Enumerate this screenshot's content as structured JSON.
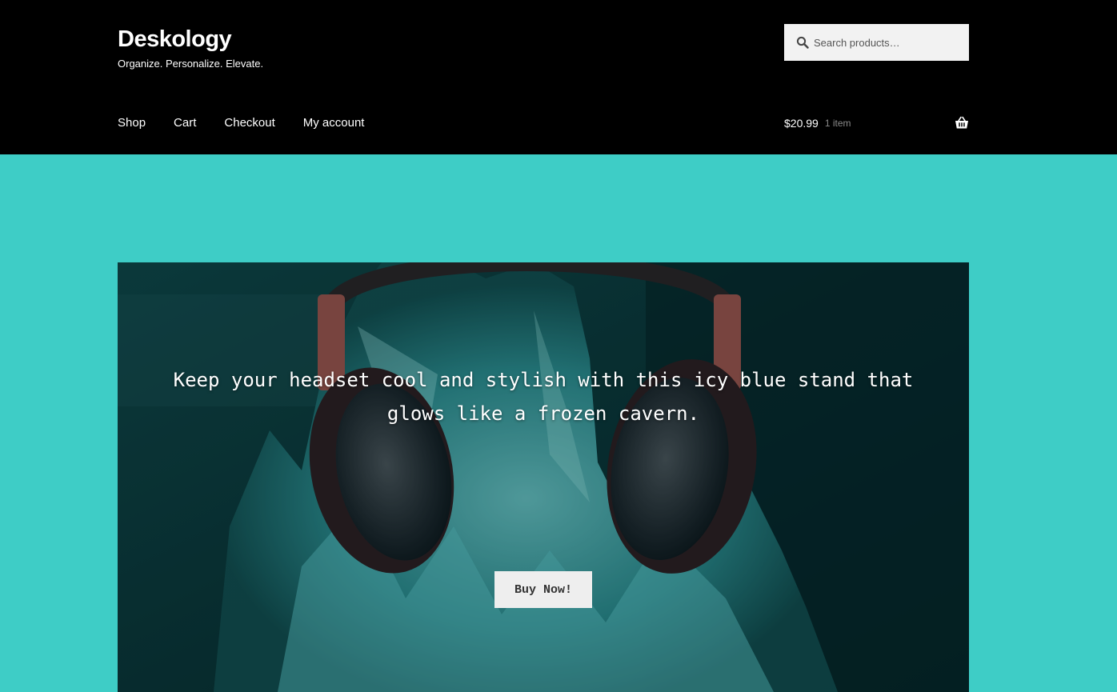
{
  "site": {
    "title": "Deskology",
    "tagline": "Organize. Personalize. Elevate."
  },
  "search": {
    "placeholder": "Search products…",
    "icon": "search-icon"
  },
  "nav": {
    "items": [
      {
        "label": "Shop"
      },
      {
        "label": "Cart"
      },
      {
        "label": "Checkout"
      },
      {
        "label": "My account"
      }
    ]
  },
  "cart": {
    "amount": "$20.99",
    "count": "1 item",
    "icon": "basket-icon"
  },
  "hero": {
    "text": "Keep your headset cool and stylish with this icy blue stand that glows like a frozen cavern.",
    "button_label": "Buy Now!"
  },
  "colors": {
    "page_background": "#3ecdc6",
    "header_background": "#000000",
    "search_background": "#f2f2f2",
    "button_background": "#eeeeee"
  }
}
